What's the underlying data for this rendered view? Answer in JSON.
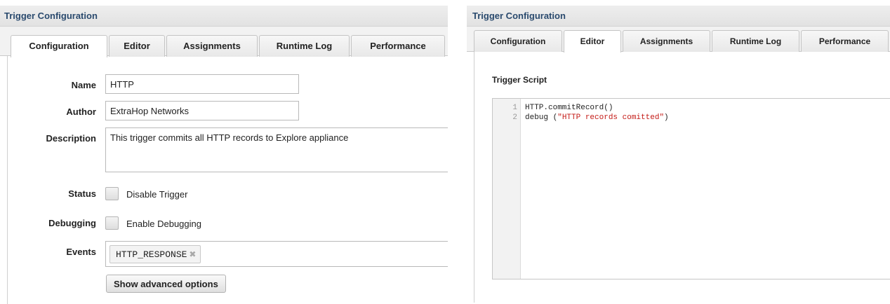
{
  "left_panel": {
    "title": "Trigger Configuration",
    "tabs": [
      {
        "label": "Configuration",
        "active": true
      },
      {
        "label": "Editor",
        "active": false
      },
      {
        "label": "Assignments",
        "active": false
      },
      {
        "label": "Runtime Log",
        "active": false
      },
      {
        "label": "Performance",
        "active": false
      }
    ],
    "fields": {
      "name_label": "Name",
      "name_value": "HTTP",
      "author_label": "Author",
      "author_value": "ExtraHop Networks",
      "description_label": "Description",
      "description_value": "This trigger commits all HTTP records to Explore appliance",
      "status_label": "Status",
      "status_checkbox_label": "Disable Trigger",
      "debugging_label": "Debugging",
      "debugging_checkbox_label": "Enable Debugging",
      "events_label": "Events",
      "events": [
        "HTTP_RESPONSE"
      ],
      "token_remove_icon": "close-icon"
    },
    "advanced_button": "Show advanced options"
  },
  "right_panel": {
    "title": "Trigger Configuration",
    "tabs": [
      {
        "label": "Configuration",
        "active": false
      },
      {
        "label": "Editor",
        "active": true
      },
      {
        "label": "Assignments",
        "active": false
      },
      {
        "label": "Runtime Log",
        "active": false
      },
      {
        "label": "Performance",
        "active": false
      }
    ],
    "script_title": "Trigger Script",
    "code_lines": [
      {
        "number": "1",
        "code": "HTTP.commitRecord()",
        "string": ""
      },
      {
        "number": "2",
        "code": "debug (",
        "string": "\"HTTP records comitted\"",
        "suffix": ")"
      }
    ]
  },
  "colors": {
    "header_text": "#2a4a6e",
    "code_string": "#c41a16"
  }
}
